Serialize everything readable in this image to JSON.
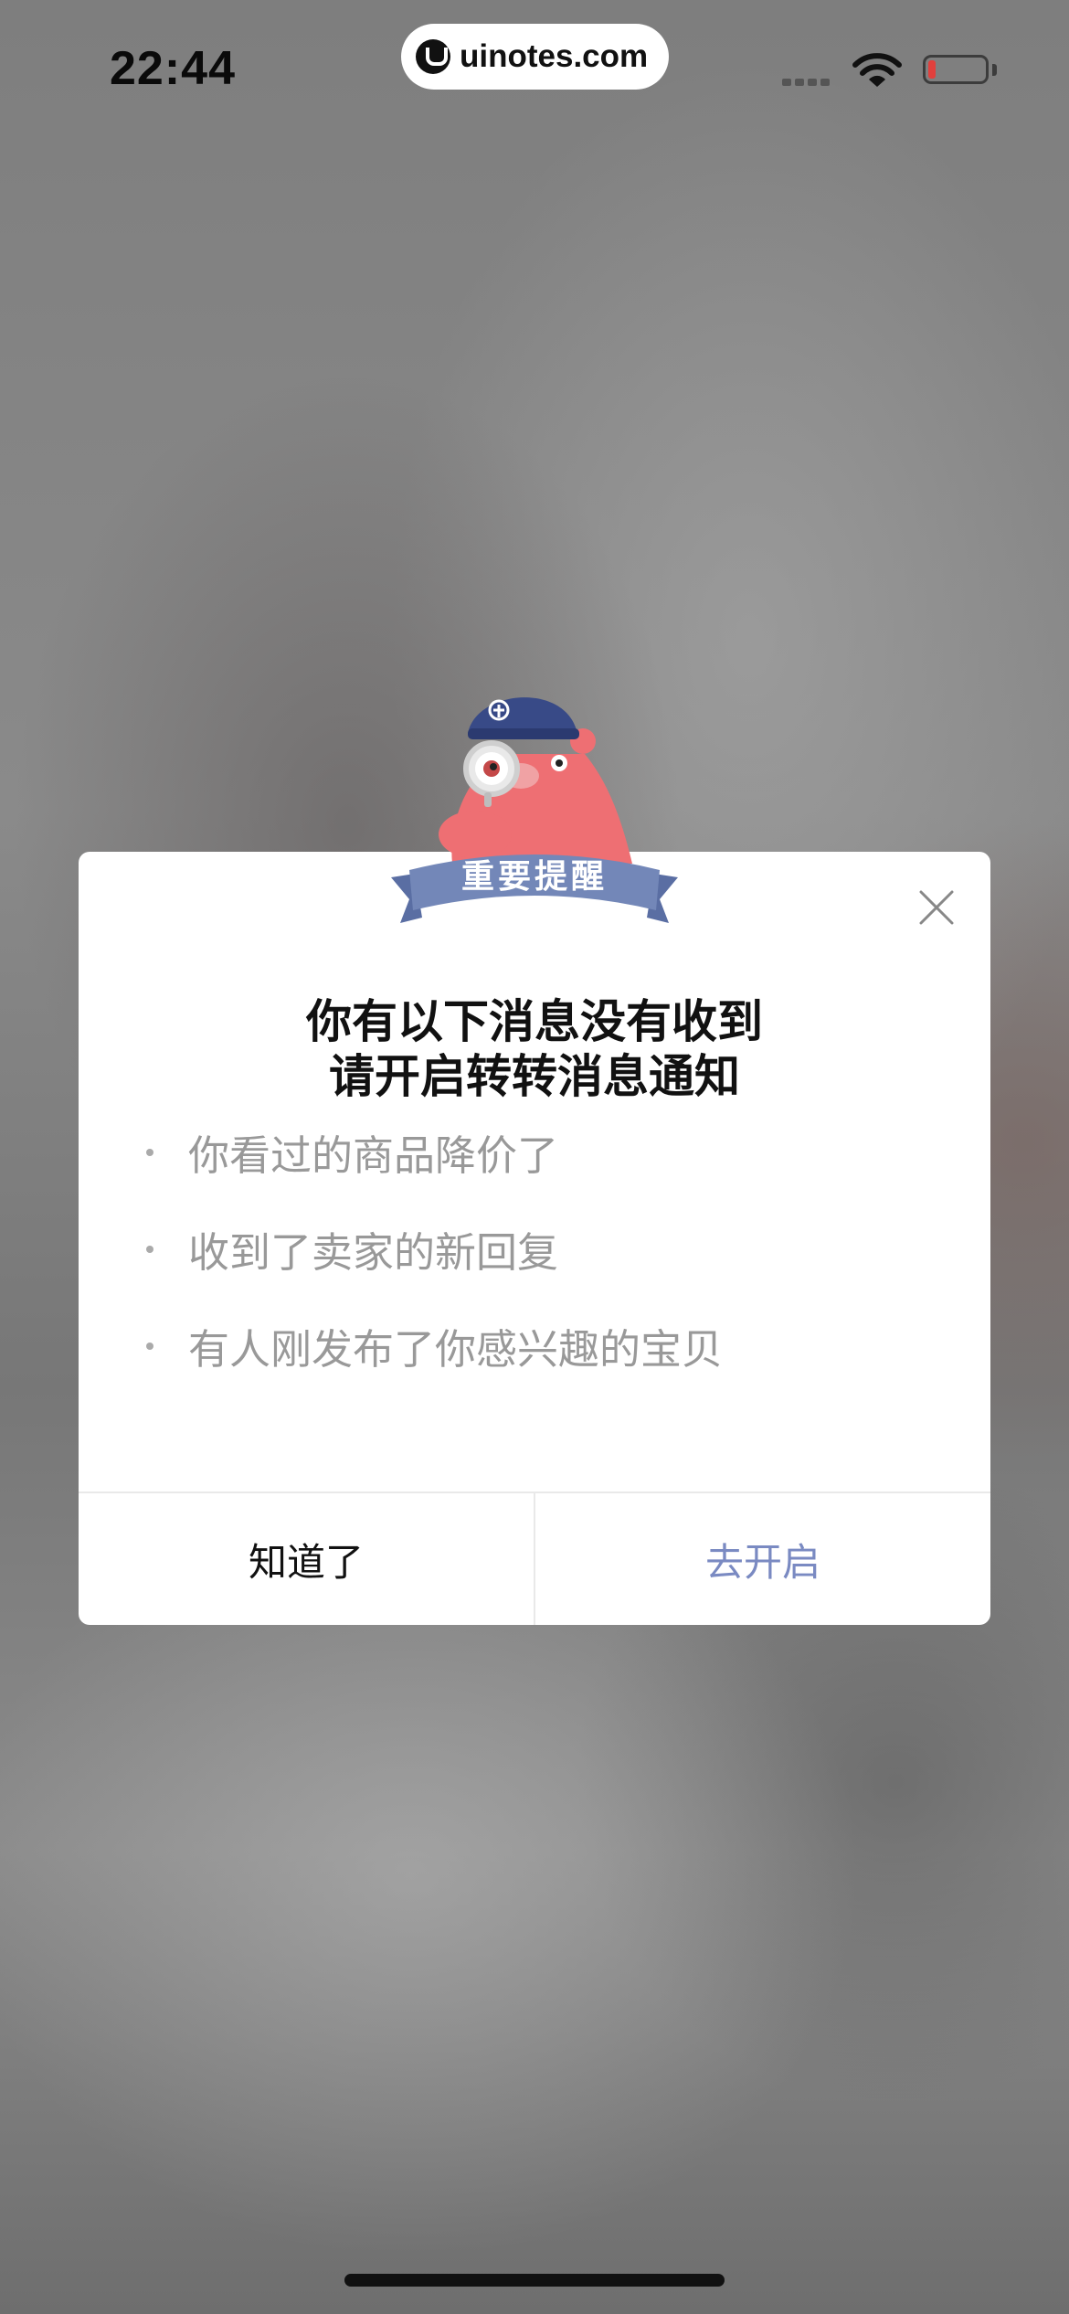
{
  "status_bar": {
    "time": "22:44",
    "url": "uinotes.com",
    "icons": [
      "signal-icon",
      "wifi-icon",
      "battery-icon"
    ]
  },
  "dialog": {
    "ribbon_label": "重要提醒",
    "title_line1": "你有以下消息没有收到",
    "title_line2": "请开启转转消息通知",
    "items": [
      "你看过的商品降价了",
      "收到了卖家的新回复",
      "有人刚发布了你感兴趣的宝贝"
    ],
    "dismiss_label": "知道了",
    "confirm_label": "去开启"
  },
  "colors": {
    "accent": "#7a8ac2",
    "ribbon": "#7387b8",
    "mascot": "#ee6f73",
    "battery_low": "#e1403d"
  }
}
